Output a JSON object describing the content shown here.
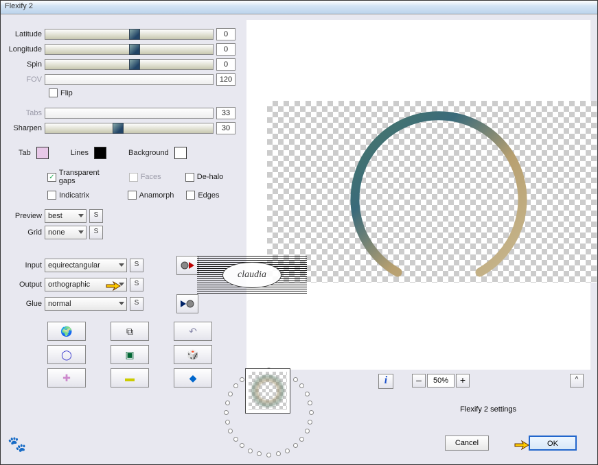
{
  "window": {
    "title": "Flexify 2"
  },
  "sliders": {
    "latitude": {
      "label": "Latitude",
      "value": "0",
      "pos": 50
    },
    "longitude": {
      "label": "Longitude",
      "value": "0",
      "pos": 50
    },
    "spin": {
      "label": "Spin",
      "value": "0",
      "pos": 50
    },
    "fov": {
      "label": "FOV",
      "value": "120",
      "disabled": true
    },
    "tabs": {
      "label": "Tabs",
      "value": "33",
      "disabled": true
    },
    "sharpen": {
      "label": "Sharpen",
      "value": "30",
      "pos": 40
    }
  },
  "flip": {
    "label": "Flip",
    "checked": false
  },
  "colors": {
    "tab": {
      "label": "Tab",
      "hex": "#e8c8e8"
    },
    "lines": {
      "label": "Lines",
      "hex": "#000000"
    },
    "background": {
      "label": "Background",
      "hex": "#ffffff"
    }
  },
  "checks": {
    "transparent_gaps": {
      "label": "Transparent gaps",
      "checked": true
    },
    "faces": {
      "label": "Faces",
      "checked": false,
      "disabled": true
    },
    "dehalo": {
      "label": "De-halo",
      "checked": false
    },
    "indicatrix": {
      "label": "Indicatrix",
      "checked": false
    },
    "anamorph": {
      "label": "Anamorph",
      "checked": false
    },
    "edges": {
      "label": "Edges",
      "checked": false
    }
  },
  "dropdowns": {
    "preview": {
      "label": "Preview",
      "value": "best"
    },
    "grid": {
      "label": "Grid",
      "value": "none"
    },
    "input": {
      "label": "Input",
      "value": "equirectangular"
    },
    "output": {
      "label": "Output",
      "value": "orthographic"
    },
    "glue": {
      "label": "Glue",
      "value": "normal"
    }
  },
  "zoom": {
    "value": "50%"
  },
  "settings_caption": "Flexify 2 settings",
  "buttons": {
    "cancel": "Cancel",
    "ok": "OK"
  },
  "watermark": "claudia",
  "icons": {
    "save_s": "S",
    "info": "i",
    "minus": "–",
    "plus": "+",
    "collapse": "^"
  }
}
